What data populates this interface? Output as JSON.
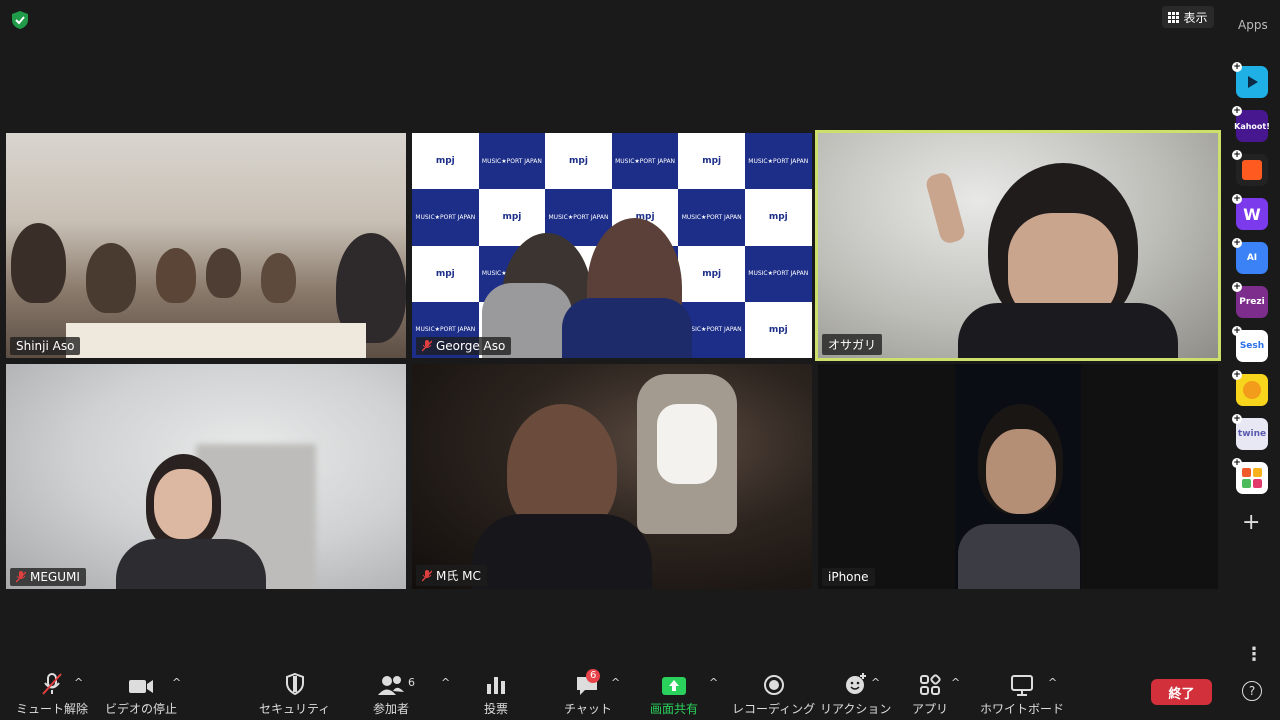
{
  "top": {
    "view_label": "表示",
    "apps_label": "Apps"
  },
  "participants": [
    {
      "name": "Shinji Aso",
      "muted": false
    },
    {
      "name": "George Aso",
      "muted": true
    },
    {
      "name": "オサガリ",
      "muted": false,
      "speaking": true
    },
    {
      "name": "MEGUMI",
      "muted": true
    },
    {
      "name": "M氏 MC",
      "muted": true
    },
    {
      "name": "iPhone",
      "muted": false
    }
  ],
  "backdrop": {
    "brand_text": "MUSIC★PORT JAPAN",
    "logo_text": "mpj"
  },
  "apps": [
    "Kahoot!",
    "AI",
    "Prezi",
    "Sesh",
    "twine"
  ],
  "toolbar": {
    "unmute_label": "ミュート解除",
    "video_label": "ビデオの停止",
    "security_label": "セキュリティ",
    "participants_label": "参加者",
    "participants_count": "6",
    "poll_label": "投票",
    "chat_label": "チャット",
    "chat_badge": "6",
    "share_label": "画面共有",
    "record_label": "レコーディング",
    "reaction_label": "リアクション",
    "apps_label": "アプリ",
    "whiteboard_label": "ホワイトボード",
    "end_label": "終了",
    "more_label": "⋮",
    "help_label": "?"
  },
  "colors": {
    "speaking_outline": "#cde06b",
    "share_green": "#2ad15c",
    "end_red": "#d2303b"
  }
}
